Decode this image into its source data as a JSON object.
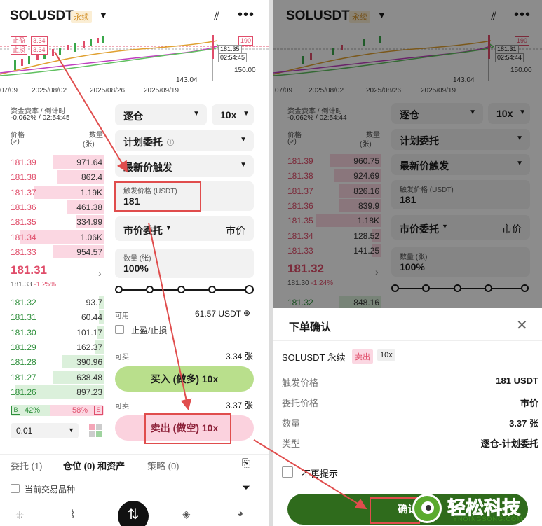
{
  "left": {
    "header": {
      "symbol": "SOLUSDT",
      "contract_type": "永续"
    },
    "chart": {
      "take_profit_label": "止盈",
      "take_profit_value": "3.34",
      "stop_loss_label": "止损",
      "stop_loss_value": "3.34",
      "price_190": "190",
      "price_181_35": "181.35",
      "countdown": "02:54:45",
      "price_150": "150.00",
      "low": "143.04",
      "dates": [
        "07/09",
        "2025/08/02",
        "2025/08/26",
        "2025/09/19"
      ]
    },
    "funding": {
      "label": "资金费率 / 倒计时",
      "value": "-0.062% / 02:54:45"
    },
    "orderbook": {
      "price_header": "价格",
      "price_unit": "(₮)",
      "qty_header": "数量",
      "qty_unit": "(张)",
      "asks": [
        {
          "price": "181.39",
          "qty": "971.64",
          "depth": 0.55
        },
        {
          "price": "181.38",
          "qty": "862.4",
          "depth": 0.5
        },
        {
          "price": "181.37",
          "qty": "1.19K",
          "depth": 0.75
        },
        {
          "price": "181.36",
          "qty": "461.38",
          "depth": 0.4
        },
        {
          "price": "181.35",
          "qty": "334.99",
          "depth": 0.3
        },
        {
          "price": "181.34",
          "qty": "1.06K",
          "depth": 0.9
        },
        {
          "price": "181.33",
          "qty": "954.57",
          "depth": 0.55
        }
      ],
      "last_price": "181.31",
      "mark_price": "181.33",
      "change": "-1.25%",
      "bids": [
        {
          "price": "181.32",
          "qty": "93.7",
          "depth": 0.05
        },
        {
          "price": "181.31",
          "qty": "60.44",
          "depth": 0.05
        },
        {
          "price": "181.30",
          "qty": "101.17",
          "depth": 0.07
        },
        {
          "price": "181.29",
          "qty": "162.37",
          "depth": 0.1
        },
        {
          "price": "181.28",
          "qty": "390.96",
          "depth": 0.45
        },
        {
          "price": "181.27",
          "qty": "638.48",
          "depth": 0.55
        },
        {
          "price": "181.26",
          "qty": "897.23",
          "depth": 0.95
        }
      ],
      "buy_ratio_label": "B",
      "buy_ratio": "42%",
      "sell_ratio": "58%",
      "sell_ratio_label": "S",
      "precision": "0.01"
    },
    "form": {
      "margin_mode": "逐仓",
      "leverage": "10x",
      "order_type": "计划委托",
      "trigger_type": "最新价触发",
      "trigger_price_label": "触发价格 (USDT)",
      "trigger_price": "181",
      "exec_type": "市价委托",
      "exec_price": "市价",
      "qty_label": "数量 (张)",
      "qty": "100%",
      "available_label": "可用",
      "available": "61.57 USDT",
      "tpsl_label": "止盈/止损",
      "can_buy_label": "可买",
      "can_buy": "3.34 张",
      "buy_button": "买入 (做多) 10x",
      "can_sell_label": "可卖",
      "can_sell": "3.37 张",
      "sell_button": "卖出 (做空) 10x"
    },
    "tabs": {
      "orders": "委托 (1)",
      "positions": "仓位 (0) 和资产",
      "strategy": "策略 (0)"
    },
    "current_only": "当前交易品种"
  },
  "right": {
    "header": {
      "symbol": "SOLUSDT",
      "contract_type": "永续"
    },
    "chart": {
      "price_181_31": "181.31",
      "countdown": "02:54:44",
      "price_150": "150.00",
      "price_190": "190",
      "low": "143.04",
      "dates": [
        "07/09",
        "2025/08/02",
        "2025/08/26",
        "2025/09/19"
      ]
    },
    "funding": {
      "label": "资金费率 / 倒计时",
      "value": "-0.062% / 02:54:44"
    },
    "orderbook": {
      "price_header": "价格",
      "price_unit": "(₮)",
      "qty_header": "数量",
      "qty_unit": "(张)",
      "asks": [
        {
          "price": "181.39",
          "qty": "960.75",
          "depth": 0.55
        },
        {
          "price": "181.38",
          "qty": "924.69",
          "depth": 0.5
        },
        {
          "price": "181.37",
          "qty": "826.16",
          "depth": 0.45
        },
        {
          "price": "181.36",
          "qty": "839.9",
          "depth": 0.45
        },
        {
          "price": "181.35",
          "qty": "1.18K",
          "depth": 0.7
        },
        {
          "price": "181.34",
          "qty": "128.52",
          "depth": 0.1
        },
        {
          "price": "181.33",
          "qty": "141.25",
          "depth": 0.1
        }
      ],
      "last_price": "181.32",
      "mark_price": "181.30",
      "change": "-1.24%",
      "first_bid": {
        "price": "181.32",
        "qty": "848.16"
      }
    },
    "form": {
      "margin_mode": "逐仓",
      "leverage": "10x",
      "order_type": "计划委托",
      "trigger_type": "最新价触发",
      "trigger_price_label": "触发价格 (USDT)",
      "trigger_price": "181",
      "exec_type": "市价委托",
      "exec_price": "市价",
      "qty_label": "数量 (张)",
      "qty": "100%"
    },
    "dialog": {
      "title": "下单确认",
      "symbol": "SOLUSDT 永续",
      "side": "卖出",
      "leverage": "10x",
      "rows": [
        {
          "k": "触发价格",
          "v": "181 USDT"
        },
        {
          "k": "委托价格",
          "v": "市价"
        },
        {
          "k": "数量",
          "v": "3.37 张"
        },
        {
          "k": "类型",
          "v": "逐仓-计划委托"
        }
      ],
      "dont_remind": "不再提示",
      "confirm": "确认"
    }
  },
  "watermark": {
    "cn": "轻松科技",
    "en": "YNQINGSONG.COM"
  }
}
